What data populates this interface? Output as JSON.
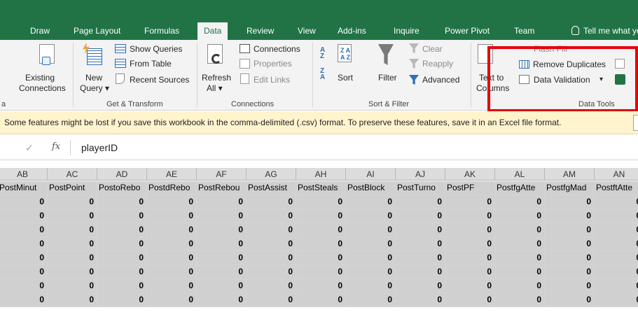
{
  "tabs": [
    {
      "id": "draw",
      "label": "Draw"
    },
    {
      "id": "page-layout",
      "label": "Page Layout"
    },
    {
      "id": "formulas",
      "label": "Formulas"
    },
    {
      "id": "data",
      "label": "Data",
      "active": true
    },
    {
      "id": "review",
      "label": "Review"
    },
    {
      "id": "view",
      "label": "View"
    },
    {
      "id": "add-ins",
      "label": "Add-ins"
    },
    {
      "id": "inquire",
      "label": "Inquire"
    },
    {
      "id": "power-pivot",
      "label": "Power Pivot"
    },
    {
      "id": "team",
      "label": "Team"
    }
  ],
  "tell_me": "Tell me what yo",
  "ribbon": {
    "left_cut_label": "a",
    "existing_connections": [
      "Existing",
      "Connections"
    ],
    "new_query": [
      "New",
      "Query ▾"
    ],
    "show_queries": "Show Queries",
    "from_table": "From Table",
    "recent_sources": "Recent Sources",
    "get_transform": "Get & Transform",
    "refresh_all": [
      "Refresh",
      "All ▾"
    ],
    "connections": "Connections",
    "properties": "Properties",
    "edit_links": "Edit Links",
    "connections_group": "Connections",
    "sort": "Sort",
    "filter": "Filter",
    "clear": "Clear",
    "reapply": "Reapply",
    "advanced": "Advanced",
    "sort_filter_group": "Sort & Filter",
    "text_to_columns": [
      "Text to",
      "Columns"
    ],
    "flash_fill": "Flash Fill",
    "remove_duplicates": "Remove Duplicates",
    "data_validation": "Data Validation",
    "data_validation_arrow": "▾",
    "data_tools_group": "Data Tools"
  },
  "message_bar": {
    "text": "Some features might be lost if you save this workbook in the comma-delimited (.csv) format. To preserve these features, save it in an Excel file format."
  },
  "formula_bar": {
    "check": "✓",
    "fx": "fx",
    "value": "playerID"
  },
  "columns": [
    "AB",
    "AC",
    "AD",
    "AE",
    "AF",
    "AG",
    "AH",
    "AI",
    "AJ",
    "AK",
    "AL",
    "AM",
    "AN"
  ],
  "header_row": [
    "PostMinut",
    "PostPoint",
    "PostoRebo",
    "PostdRebo",
    "PostRebou",
    "PostAssist",
    "PostSteals",
    "PostBlock",
    "PostTurno",
    "PostPF",
    "PostfgAtte",
    "PostfgMad",
    "PostftAtte"
  ],
  "data_rows": [
    [
      "0",
      "0",
      "0",
      "0",
      "0",
      "0",
      "0",
      "0",
      "0",
      "0",
      "0",
      "0",
      "0"
    ],
    [
      "0",
      "0",
      "0",
      "0",
      "0",
      "0",
      "0",
      "0",
      "0",
      "0",
      "0",
      "0",
      "0"
    ],
    [
      "0",
      "0",
      "0",
      "0",
      "0",
      "0",
      "0",
      "0",
      "0",
      "0",
      "0",
      "0",
      "0"
    ],
    [
      "0",
      "0",
      "0",
      "0",
      "0",
      "0",
      "0",
      "0",
      "0",
      "0",
      "0",
      "0",
      "0"
    ],
    [
      "0",
      "0",
      "0",
      "0",
      "0",
      "0",
      "0",
      "0",
      "0",
      "0",
      "0",
      "0",
      "0"
    ],
    [
      "0",
      "0",
      "0",
      "0",
      "0",
      "0",
      "0",
      "0",
      "0",
      "0",
      "0",
      "0",
      "0"
    ],
    [
      "0",
      "0",
      "0",
      "0",
      "0",
      "0",
      "0",
      "0",
      "0",
      "0",
      "0",
      "0",
      "0"
    ],
    [
      "0",
      "0",
      "0",
      "0",
      "0",
      "0",
      "0",
      "0",
      "0",
      "0",
      "0",
      "0",
      "0"
    ]
  ],
  "colors": {
    "brand": "#217346",
    "highlight_box": "#e8000b",
    "cell_fill": "#d0d0d0",
    "message_bar": "#fff4ce"
  }
}
